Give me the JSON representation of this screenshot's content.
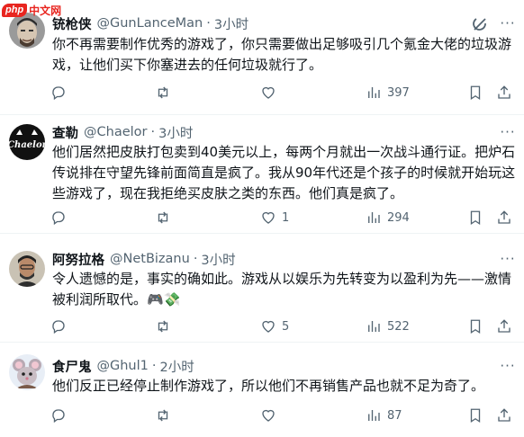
{
  "watermark": {
    "badge": "php",
    "text": "中文网"
  },
  "tweets": [
    {
      "name": "铳枪侠",
      "handle": "@GunLanceMan",
      "separator": "·",
      "time": "3小时",
      "text": "你不再需要制作优秀的游戏了，你只需要做出足够吸引几个氪金大佬的垃圾游戏，让他们买下你塞进去的任何垃圾就行了。",
      "replies": "",
      "reposts": "",
      "likes": "",
      "views": "397",
      "avatar_icon": "man-face-avatar"
    },
    {
      "name": "查勒",
      "handle": "@Chaelor",
      "separator": "·",
      "time": "3小时",
      "text": "他们居然把皮肤打包卖到40美元以上，每两个月就出一次战斗通行证。把炉石传说排在守望先锋前面简直是疯了。我从90年代还是个孩子的时候就开始玩这些游戏了，现在我拒绝买皮肤之类的东西。他们真是疯了。",
      "replies": "",
      "reposts": "",
      "likes": "1",
      "views": "294",
      "avatar_text": "Chaelor"
    },
    {
      "name": "阿努拉格",
      "handle": "@NetBizanu",
      "separator": "·",
      "time": "3小时",
      "text": "令人遗憾的是，事实的确如此。游戏从以娱乐为先转变为以盈利为先——激情被利润所取代。🎮💸",
      "replies": "",
      "reposts": "",
      "likes": "5",
      "views": "522",
      "avatar_icon": "person-avatar"
    },
    {
      "name": "食尸鬼",
      "handle": "@Ghul1",
      "separator": "·",
      "time": "2小时",
      "text": "他们反正已经停止制作游戏了，所以他们不再销售产品也就不足为奇了。",
      "replies": "",
      "reposts": "",
      "likes": "",
      "views": "87",
      "avatar_icon": "mouse-avatar"
    }
  ],
  "icons": {
    "reply": "reply-icon",
    "repost": "repost-icon",
    "like": "heart-icon",
    "views": "views-icon",
    "bookmark": "bookmark-icon",
    "share": "share-icon",
    "grok": "grok-icon",
    "more": "more-icon"
  },
  "more_glyph": "···",
  "colors": {
    "text": "#0f1419",
    "secondary": "#536471",
    "border": "#eff3f4",
    "watermark": "#e8251f"
  }
}
